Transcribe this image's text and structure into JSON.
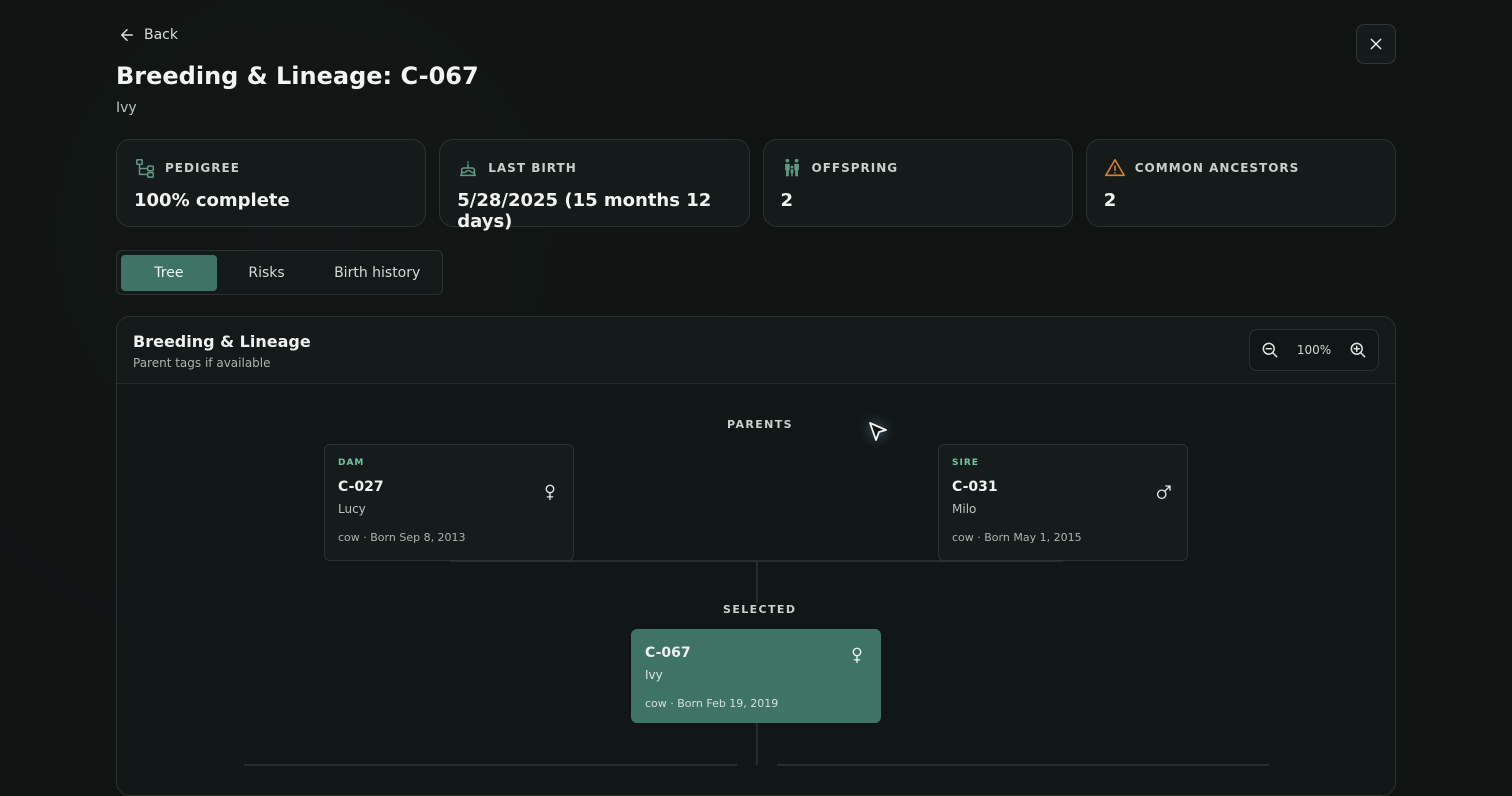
{
  "header": {
    "back_label": "Back",
    "title": "Breeding & Lineage: C-067",
    "subtitle": "Ivy"
  },
  "stats": [
    {
      "icon": "pedigree-icon",
      "label": "PEDIGREE",
      "value": "100% complete"
    },
    {
      "icon": "birth-cake-icon",
      "label": "LAST BIRTH",
      "value": "5/28/2025 (15 months 12 days)"
    },
    {
      "icon": "offspring-icon",
      "label": "OFFSPRING",
      "value": "2"
    },
    {
      "icon": "warning-icon",
      "label": "COMMON ANCESTORS",
      "value": "2"
    }
  ],
  "tabs": [
    {
      "label": "Tree",
      "active": true
    },
    {
      "label": "Risks",
      "active": false
    },
    {
      "label": "Birth history",
      "active": false
    }
  ],
  "panel": {
    "title": "Breeding & Lineage",
    "subtitle": "Parent tags if available",
    "zoom": "100%"
  },
  "tree": {
    "parents_label": "PARENTS",
    "selected_label": "SELECTED",
    "dam": {
      "role": "DAM",
      "tag": "C-027",
      "name": "Lucy",
      "meta": "cow · Born Sep 8, 2013",
      "sex": "female"
    },
    "sire": {
      "role": "SIRE",
      "tag": "C-031",
      "name": "Milo",
      "meta": "cow · Born May 1, 2015",
      "sex": "male"
    },
    "selected": {
      "tag": "C-067",
      "name": "Ivy",
      "meta": "cow · Born Feb 19, 2019",
      "sex": "female"
    }
  },
  "colors": {
    "accent": "#3e7366",
    "role_green": "#6fc59c",
    "warning": "#d9822b",
    "background": "#0f1413"
  }
}
